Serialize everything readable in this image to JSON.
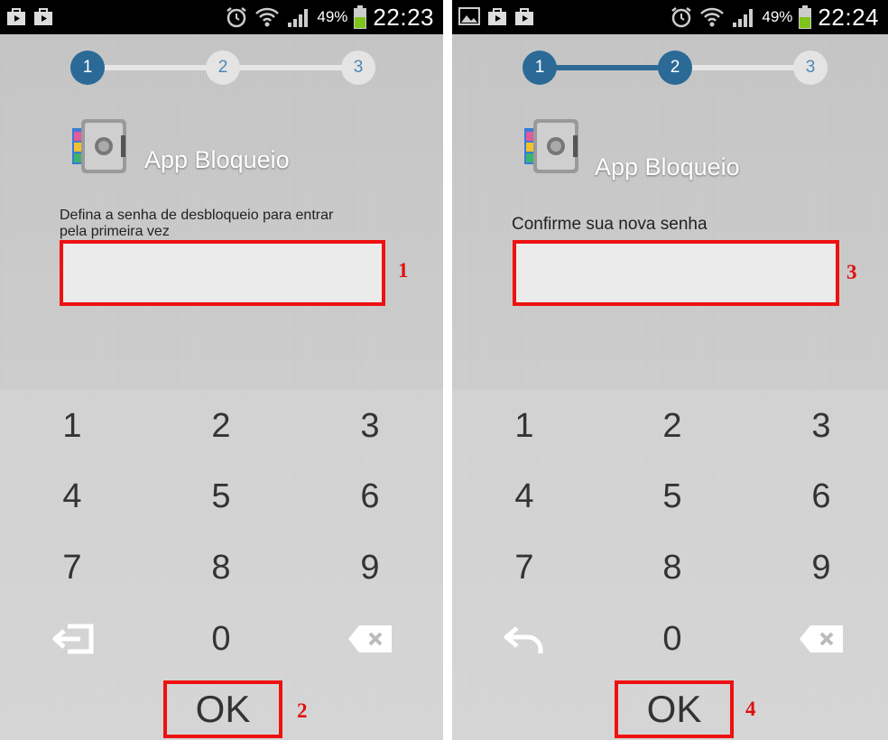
{
  "screens": [
    {
      "status": {
        "battery": "49%",
        "time": "22:23"
      },
      "steps": [
        "1",
        "2",
        "3"
      ],
      "current_step": 1,
      "app_title": "App Bloqueio",
      "prompt_line1": "Defina a senha de desbloqueio para entrar",
      "prompt_line2": "pela primeira vez",
      "input_value": "",
      "keys": [
        "1",
        "2",
        "3",
        "4",
        "5",
        "6",
        "7",
        "8",
        "9",
        "0"
      ],
      "ok_label": "OK",
      "annotation_input": "1",
      "annotation_ok": "2"
    },
    {
      "status": {
        "battery": "49%",
        "time": "22:24"
      },
      "steps": [
        "1",
        "2",
        "3"
      ],
      "current_step": 2,
      "app_title": "App Bloqueio",
      "prompt_line1": "Confirme sua nova senha",
      "input_value": "",
      "keys": [
        "1",
        "2",
        "3",
        "4",
        "5",
        "6",
        "7",
        "8",
        "9",
        "0"
      ],
      "ok_label": "OK",
      "annotation_input": "3",
      "annotation_ok": "4"
    }
  ],
  "icons": {
    "status_left_a": [
      "play-store-icon",
      "play-store-icon"
    ],
    "status_left_b": [
      "gallery-icon",
      "play-store-icon",
      "play-store-icon"
    ],
    "status_right": [
      "alarm-icon",
      "wifi-icon",
      "signal-icon",
      "battery-icon"
    ],
    "key_left_a": "exit-icon",
    "key_left_b": "back-arrow-icon",
    "key_right": "backspace-icon",
    "logo": "vault-safe-icon"
  },
  "colors": {
    "step_active": "#2b6a96",
    "annotation": "#e01010"
  }
}
